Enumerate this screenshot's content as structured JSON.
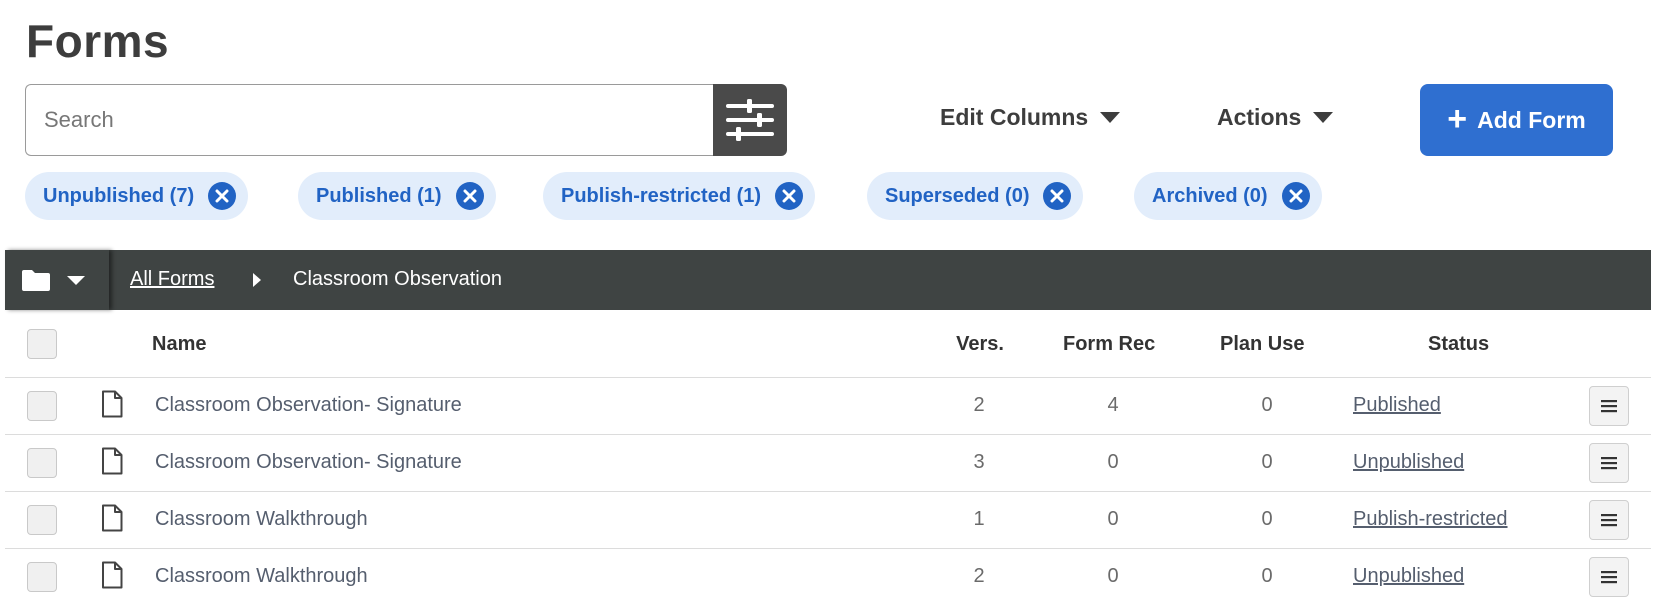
{
  "page": {
    "title": "Forms"
  },
  "search": {
    "placeholder": "Search",
    "value": ""
  },
  "toolbar": {
    "filter_icon": "sliders-icon",
    "edit_columns_label": "Edit Columns",
    "actions_label": "Actions",
    "add_form_label": "Add Form"
  },
  "filters": [
    {
      "label": "Unpublished (7)"
    },
    {
      "label": "Published (1)"
    },
    {
      "label": "Publish-restricted (1)"
    },
    {
      "label": "Superseded (0)"
    },
    {
      "label": "Archived (0)"
    }
  ],
  "breadcrumb": {
    "root": "All Forms",
    "current": "Classroom Observation"
  },
  "table": {
    "columns": {
      "name": "Name",
      "version": "Vers.",
      "form_rec": "Form Rec",
      "plan_use": "Plan Use",
      "status": "Status"
    },
    "rows": [
      {
        "name": "Classroom Observation- Signature",
        "version": "2",
        "form_rec": "4",
        "plan_use": "0",
        "status": "Published"
      },
      {
        "name": "Classroom Observation- Signature",
        "version": "3",
        "form_rec": "0",
        "plan_use": "0",
        "status": "Unpublished"
      },
      {
        "name": "Classroom Walkthrough",
        "version": "1",
        "form_rec": "0",
        "plan_use": "0",
        "status": "Publish-restricted"
      },
      {
        "name": "Classroom Walkthrough",
        "version": "2",
        "form_rec": "0",
        "plan_use": "0",
        "status": "Unpublished"
      }
    ]
  },
  "colors": {
    "accent": "#2f6fd0",
    "chip_bg": "#e2edfb",
    "chip_text": "#2163c4",
    "bar_bg": "#3f4443"
  }
}
